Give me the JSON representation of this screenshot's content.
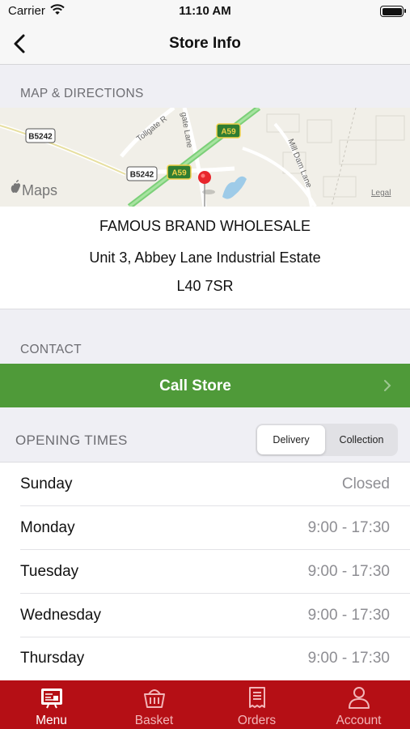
{
  "status_bar": {
    "carrier": "Carrier",
    "time": "11:10 AM"
  },
  "nav": {
    "title": "Store Info",
    "back_icon": "chevron-left-icon"
  },
  "map_section": {
    "header": "MAP & DIRECTIONS",
    "map": {
      "road_labels": [
        "B5242",
        "A59",
        "A59",
        "B5242"
      ],
      "street_labels": [
        "Tollgate R",
        "gate Lane",
        "Mill Dam Lane"
      ],
      "brand": "Maps",
      "legal": "Legal"
    }
  },
  "address": {
    "name": "FAMOUS BRAND WHOLESALE",
    "street": "Unit 3, Abbey Lane Industrial Estate",
    "postcode": "L40 7SR"
  },
  "contact": {
    "header": "CONTACT",
    "call_label": "Call Store"
  },
  "opening": {
    "header": "OPENING TIMES",
    "segments": [
      "Delivery",
      "Collection"
    ],
    "selected": "Delivery",
    "days": [
      {
        "day": "Sunday",
        "hours": "Closed"
      },
      {
        "day": "Monday",
        "hours": "9:00 - 17:30"
      },
      {
        "day": "Tuesday",
        "hours": "9:00 - 17:30"
      },
      {
        "day": "Wednesday",
        "hours": "9:00 - 17:30"
      },
      {
        "day": "Thursday",
        "hours": "9:00 - 17:30"
      }
    ]
  },
  "tabs": [
    {
      "label": "Menu",
      "icon": "menu-board-icon",
      "active": true
    },
    {
      "label": "Basket",
      "icon": "basket-icon",
      "active": false
    },
    {
      "label": "Orders",
      "icon": "orders-receipt-icon",
      "active": false
    },
    {
      "label": "Account",
      "icon": "person-icon",
      "active": false
    }
  ],
  "colors": {
    "brand_red": "#b50f15",
    "call_green": "#4f9a39",
    "map_pin": "#e8262d"
  }
}
